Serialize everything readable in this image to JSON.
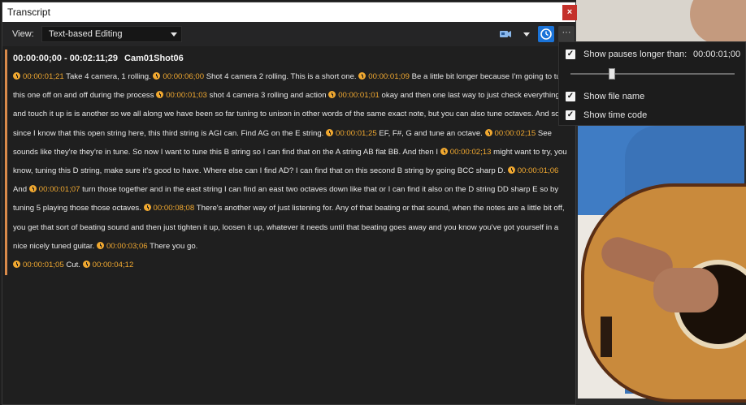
{
  "window": {
    "title": "Transcript",
    "close_label": "×"
  },
  "toolbar": {
    "view_label": "View:",
    "view_value": "Text-based Editing",
    "more_label": "···"
  },
  "clip": {
    "range": "00:00:00;00 - 00:02:11;29",
    "name": "Cam01Shot06"
  },
  "segments": [
    {
      "ts": "00:00:01;21",
      "text": " Take 4 camera, 1 rolling. "
    },
    {
      "ts": "00:00:06;00",
      "text": " Shot 4 camera 2 rolling. This is a short one. "
    },
    {
      "ts": "00:00:01;09",
      "text": " Be a little bit longer because I'm going to turn this one off on and off during the process "
    },
    {
      "ts": "00:00:01;03",
      "text": " shot 4 camera 3 rolling and action "
    },
    {
      "ts": "00:00:01;01",
      "text": " okay and then one last way to just check everything and touch it up is is another so we all along we have been so far tuning to unison in other words of the same exact note, but you can also tune octaves. And so since I know that this open string here, this third string is AGI can. Find AG on the E string. "
    },
    {
      "ts": "00:00:01;25",
      "text": " EF, F#, G and tune an octave. "
    },
    {
      "ts": "00:00:02;15",
      "text": " See sounds like they're they're in tune. So now I want to tune this B string so I can find that on the A string AB flat BB. And then I "
    },
    {
      "ts": "00:00:02;13",
      "text": " might want to try, you know, tuning this D string, make sure it's good to have. Where else can I find AD? I can find that on this second B string by going BCC sharp D. "
    },
    {
      "ts": "00:00:01;06",
      "text": " And "
    },
    {
      "ts": "00:00:01;07",
      "text": " turn those together and in the east string I can find an east two octaves down like that or I can find it also on the D string DD sharp E so by tuning 5 playing those those octaves. "
    },
    {
      "ts": "00:00:08;08",
      "text": " There's another way of just listening for. Any of that beating or that sound, when the notes are a little bit off, you get that sort of beating sound and then just tighten it up, loosen it up, whatever it needs until that beating goes away and you know you've got yourself in a nice nicely tuned guitar. "
    },
    {
      "ts": "00:00:03;06",
      "text": " There you go."
    },
    {
      "ts": "00:00:01;05",
      "text": " Cut. "
    },
    {
      "ts": "00:00:04;12",
      "text": ""
    }
  ],
  "popup": {
    "pauses_label": "Show pauses longer than:",
    "pauses_value": "00:00:01;00",
    "pauses_checked": true,
    "slider_fraction": 0.25,
    "file_name_label": "Show file name",
    "file_name_checked": true,
    "time_code_label": "Show time code",
    "time_code_checked": true
  },
  "colors": {
    "accent": "#d98a4a",
    "timecode": "#f0a830",
    "toggle_active": "#1a73d8",
    "close": "#c4312b"
  }
}
